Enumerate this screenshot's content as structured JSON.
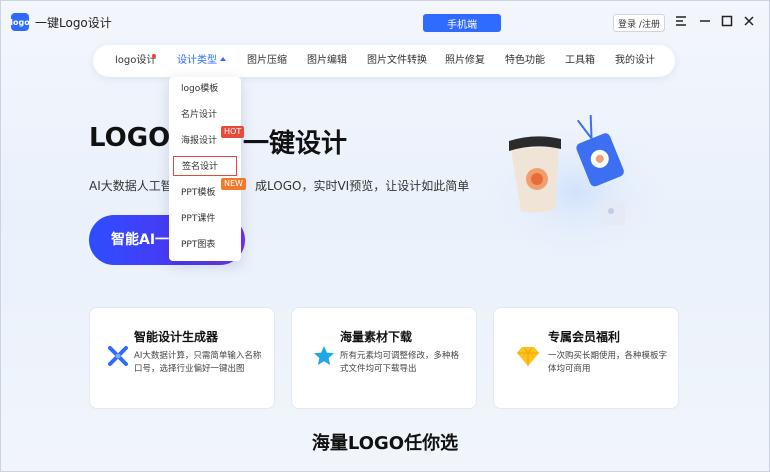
{
  "app": {
    "logo_text": "logo",
    "title": "一键Logo设计",
    "mobile_button": "手机端",
    "login_button": "登录 /注册"
  },
  "nav": {
    "items": [
      {
        "label": "logo设计"
      },
      {
        "label": "设计类型"
      },
      {
        "label": "图片压缩"
      },
      {
        "label": "图片编辑"
      },
      {
        "label": "图片文件转换"
      },
      {
        "label": "照片修复"
      },
      {
        "label": "特色功能"
      },
      {
        "label": "工具箱"
      },
      {
        "label": "我的设计"
      }
    ]
  },
  "dropdown": {
    "items": [
      {
        "label": "logo模板"
      },
      {
        "label": "名片设计"
      },
      {
        "label": "海报设计"
      },
      {
        "label": "签名设计"
      },
      {
        "label": "PPT模板"
      },
      {
        "label": "PPT课件"
      },
      {
        "label": "PPT图表"
      }
    ],
    "badge_hot": "HOT",
    "badge_new": "NEW"
  },
  "hero": {
    "title_left": "LOGO·",
    "title_right": "一键设计",
    "subtitle_left": "AI大数据人工智",
    "subtitle_right": "成LOGO，实时VI预览，让设计如此简单",
    "cta": "智能AI一"
  },
  "features": [
    {
      "title": "智能设计生成器",
      "desc": "AI大数据计算，只需简单输入名称口号，选择行业偏好一键出图",
      "icon": "x-shape-icon"
    },
    {
      "title": "海量素材下载",
      "desc": "所有元素均可调整修改，多种格式文件均可下载导出",
      "icon": "star-icon"
    },
    {
      "title": "专属会员福利",
      "desc": "一次购买长期使用，各种模板字体均可商用",
      "icon": "diamond-icon"
    }
  ],
  "section_title": "海量LOGO任你选",
  "colors": {
    "accent": "#2f6bff",
    "hot": "#e84a3c",
    "new": "#f07a2a"
  }
}
